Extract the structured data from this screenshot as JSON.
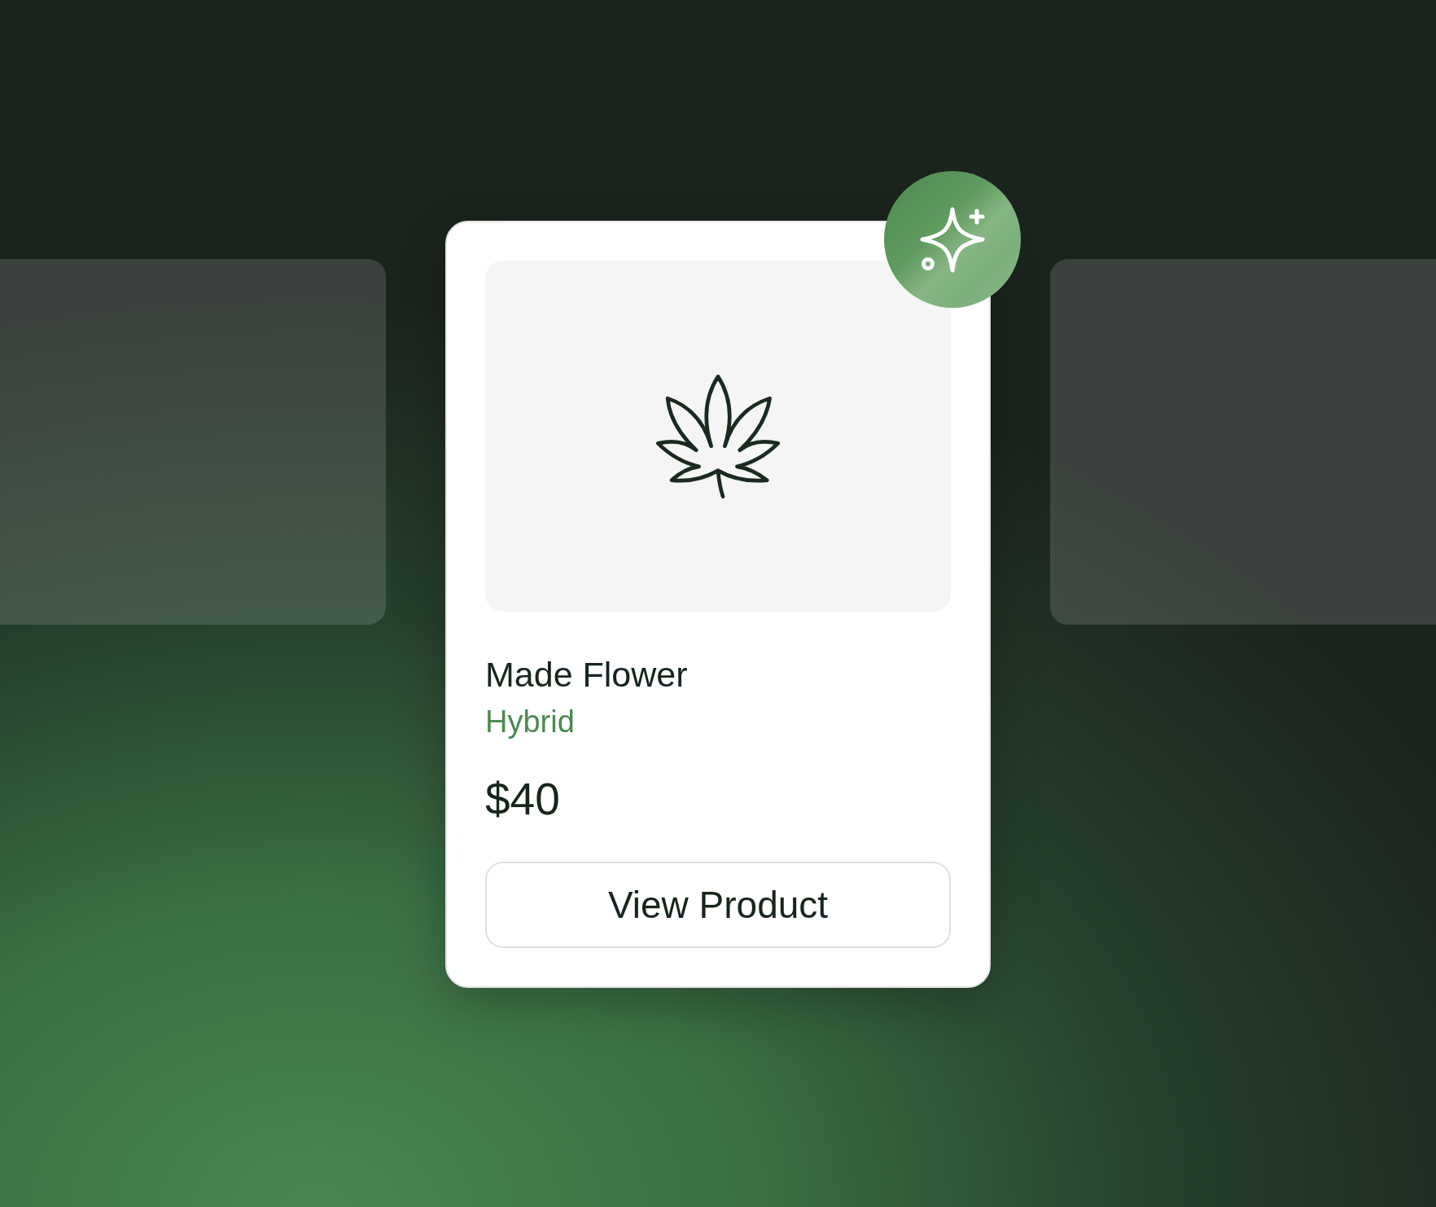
{
  "product_card": {
    "name": "Made Flower",
    "category": "Hybrid",
    "price": "$40",
    "button": {
      "label": "View Product"
    }
  }
}
